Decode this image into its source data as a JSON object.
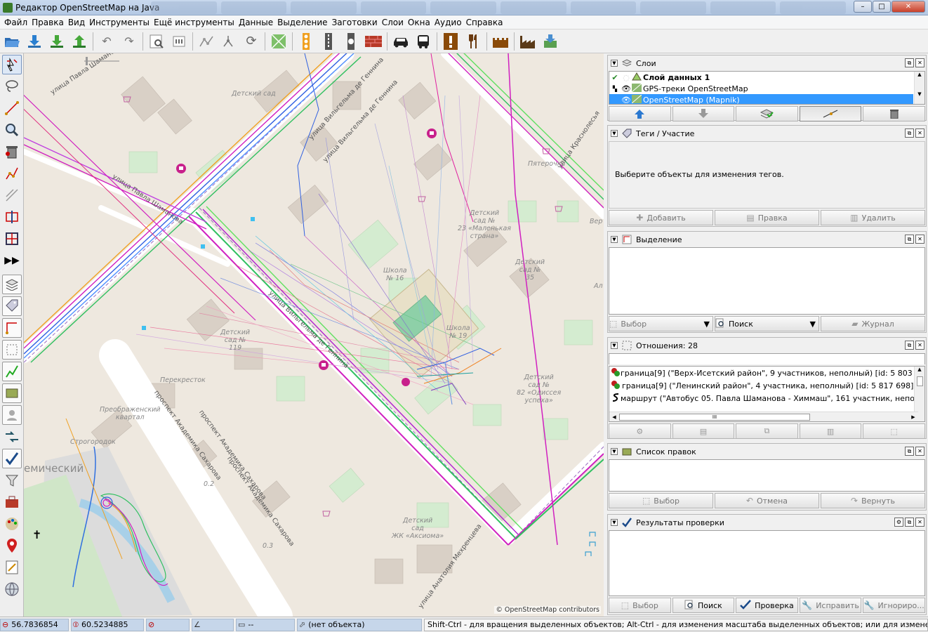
{
  "window": {
    "title": "Редактор OpenStreetMap на Java",
    "min": "–",
    "max": "□",
    "close": "✕"
  },
  "menu": [
    "Файл",
    "Правка",
    "Вид",
    "Инструменты",
    "Ещё инструменты",
    "Данные",
    "Выделение",
    "Заготовки",
    "Слои",
    "Окна",
    "Аудио",
    "Справка"
  ],
  "toolbar_icons": [
    "open-icon",
    "download-icon",
    "download-along-icon",
    "upload-icon",
    "undo-icon",
    "redo-icon",
    "search-area-icon",
    "preferences-icon",
    "wireframe-icon",
    "split-icon",
    "refresh-icon",
    "layers-icon",
    "traffic-signals-icon",
    "crossing-icon",
    "stop-icon",
    "wall-icon",
    "car-icon",
    "bus-icon",
    "hazard-icon",
    "restaurant-icon",
    "castle-icon",
    "industry-icon",
    "download-data-icon"
  ],
  "lefttools": [
    "select-icon",
    "lasso-icon",
    "draw-icon",
    "zoom-icon",
    "delete-icon",
    "improve-way-icon",
    "parallel-icon",
    "extrude-icon",
    "more-icon"
  ],
  "map": {
    "labels": [
      {
        "text": "Детский\nсад"
      },
      {
        "text": "Пятерочка"
      },
      {
        "text": "Детский\nсад №\n23 «Маленькая\nстрана»"
      },
      {
        "text": "Детский\nсад №\n35"
      },
      {
        "text": "Школа\n№ 16"
      },
      {
        "text": "Школа\n№ 19"
      },
      {
        "text": "Детский\nсад №\n119"
      },
      {
        "text": "Перекресток"
      },
      {
        "text": "Детский\nсад №\n82 «Одиссея\nуспеха»"
      },
      {
        "text": "Преображенский\nквартал"
      },
      {
        "text": "Строгородок"
      },
      {
        "text": "Детский\nсад\nЖК «Аксиома»"
      },
      {
        "text": "0.2"
      },
      {
        "text": "0.3"
      },
      {
        "text": "Вер"
      },
      {
        "text": "Ал"
      }
    ],
    "roads": [
      {
        "text": "улица Павла Шаманова"
      },
      {
        "text": "улица Вильгельма де Геннина"
      },
      {
        "text": "улица Вильгельма де Геннина"
      },
      {
        "text": "улица Краснолесья"
      },
      {
        "text": "улица Вильгельма де Геннина"
      },
      {
        "text": "проспект Академика Сахарова"
      },
      {
        "text": "проспект Академика Сахарова"
      },
      {
        "text": "проспект Академика Сахарова"
      },
      {
        "text": "улица Анатолия Мехренцева"
      },
      {
        "text": "улица Павла Шаманова"
      }
    ],
    "district": "емический",
    "attribution": "© OpenStreetMap contributors"
  },
  "panels": {
    "layers": {
      "title": "Слои",
      "items": [
        {
          "name": "Слой данных 1",
          "bold": true
        },
        {
          "name": "GPS-треки OpenStreetMap",
          "bold": false
        },
        {
          "name": "OpenStreetMap (Mapnik)",
          "bold": false
        }
      ]
    },
    "tags": {
      "title": "Теги / Участие",
      "empty": "Выберите объекты для изменения тегов.",
      "buttons": [
        "Добавить",
        "Правка",
        "Удалить"
      ]
    },
    "selection": {
      "title": "Выделение",
      "buttons": [
        "Выбор",
        "Поиск",
        "Журнал"
      ]
    },
    "relations": {
      "title": "Отношения: 28",
      "items": [
        "граница[9] (\"Верх-Исетский район\", 9 участников, неполный) [id: 5 803 327]",
        "граница[9] (\"Ленинский район\", 4 участника, неполный) [id: 5 817 698]",
        "маршрут (\"Автобус 05. Павла Шаманова - Химмаш\", 161 участник, неполный) [id:"
      ],
      "scroll_mid": "III"
    },
    "changesets": {
      "title": "Список правок",
      "buttons": [
        "Выбор",
        "Отмена",
        "Вернуть"
      ]
    },
    "validation": {
      "title": "Результаты проверки",
      "buttons": [
        "Выбор",
        "Поиск",
        "Проверка",
        "Исправить",
        "Игнориро..."
      ]
    }
  },
  "status": {
    "lat": "56.7836854",
    "lon": "60.5234885",
    "heading": "",
    "angle": "",
    "distance": "--",
    "object": "(нет объекта)",
    "message": "Shift-Ctrl - для вращения выделенных объектов; Alt-Ctrl - для изменения масштаба выделенных объектов; или для изменения выделения"
  }
}
